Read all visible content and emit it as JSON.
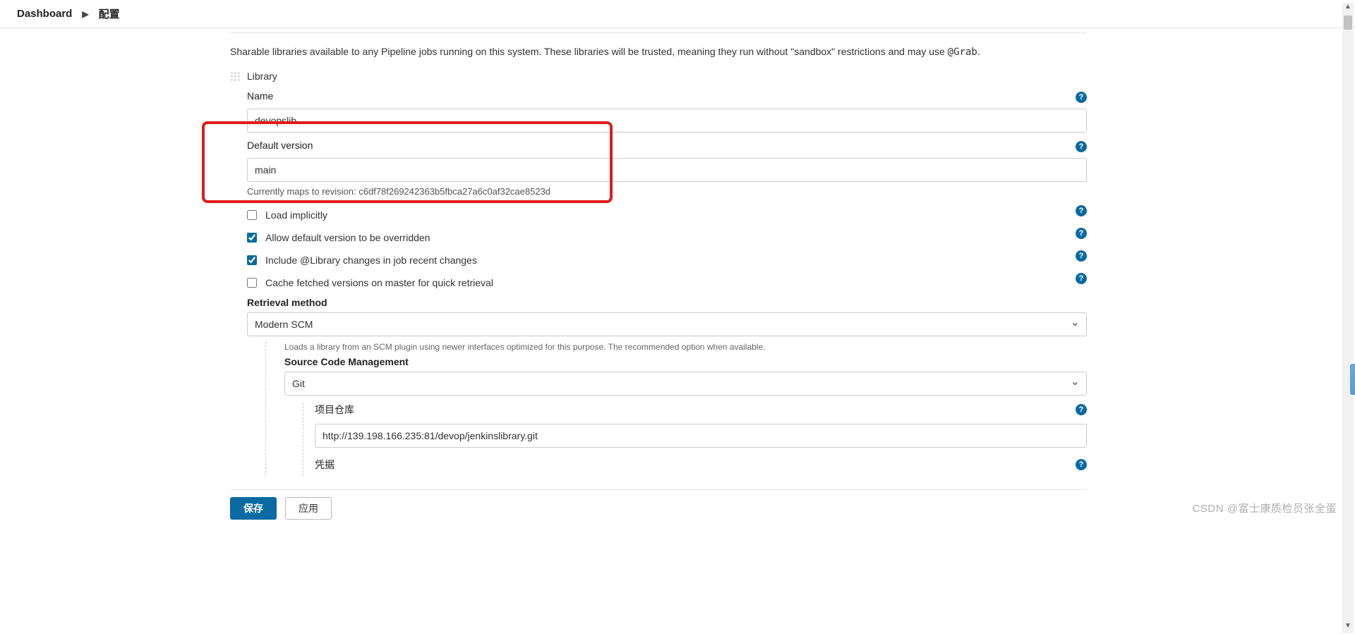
{
  "breadcrumb": {
    "root": "Dashboard",
    "current": "配置"
  },
  "section": {
    "description_pre": "Sharable libraries available to any Pipeline jobs running on this system. These libraries will be trusted, meaning they run without \"sandbox\" restrictions and may use ",
    "description_code": "@Grab",
    "description_post": ".",
    "library_label": "Library"
  },
  "library": {
    "name_label": "Name",
    "name_value": "devopslib",
    "default_version_label": "Default version",
    "default_version_value": "main",
    "revision_text": "Currently maps to revision: c6df78f269242363b5fbca27a6c0af32cae8523d",
    "checkbox_load_implicitly": "Load implicitly",
    "checkbox_allow_override": "Allow default version to be overridden",
    "checkbox_include_changes": "Include @Library changes in job recent changes",
    "checkbox_cache": "Cache fetched versions on master for quick retrieval",
    "retrieval_label": "Retrieval method",
    "retrieval_value": "Modern SCM",
    "retrieval_hint": "Loads a library from an SCM plugin using newer interfaces optimized for this purpose. The recommended option when available.",
    "scm_label": "Source Code Management",
    "scm_value": "Git",
    "repo_label": "项目仓库",
    "repo_value": "http://139.198.166.235:81/devop/jenkinslibrary.git",
    "cred_label": "凭据"
  },
  "buttons": {
    "save": "保存",
    "apply": "应用"
  },
  "watermark": "CSDN @富士康质检员张全蛋"
}
